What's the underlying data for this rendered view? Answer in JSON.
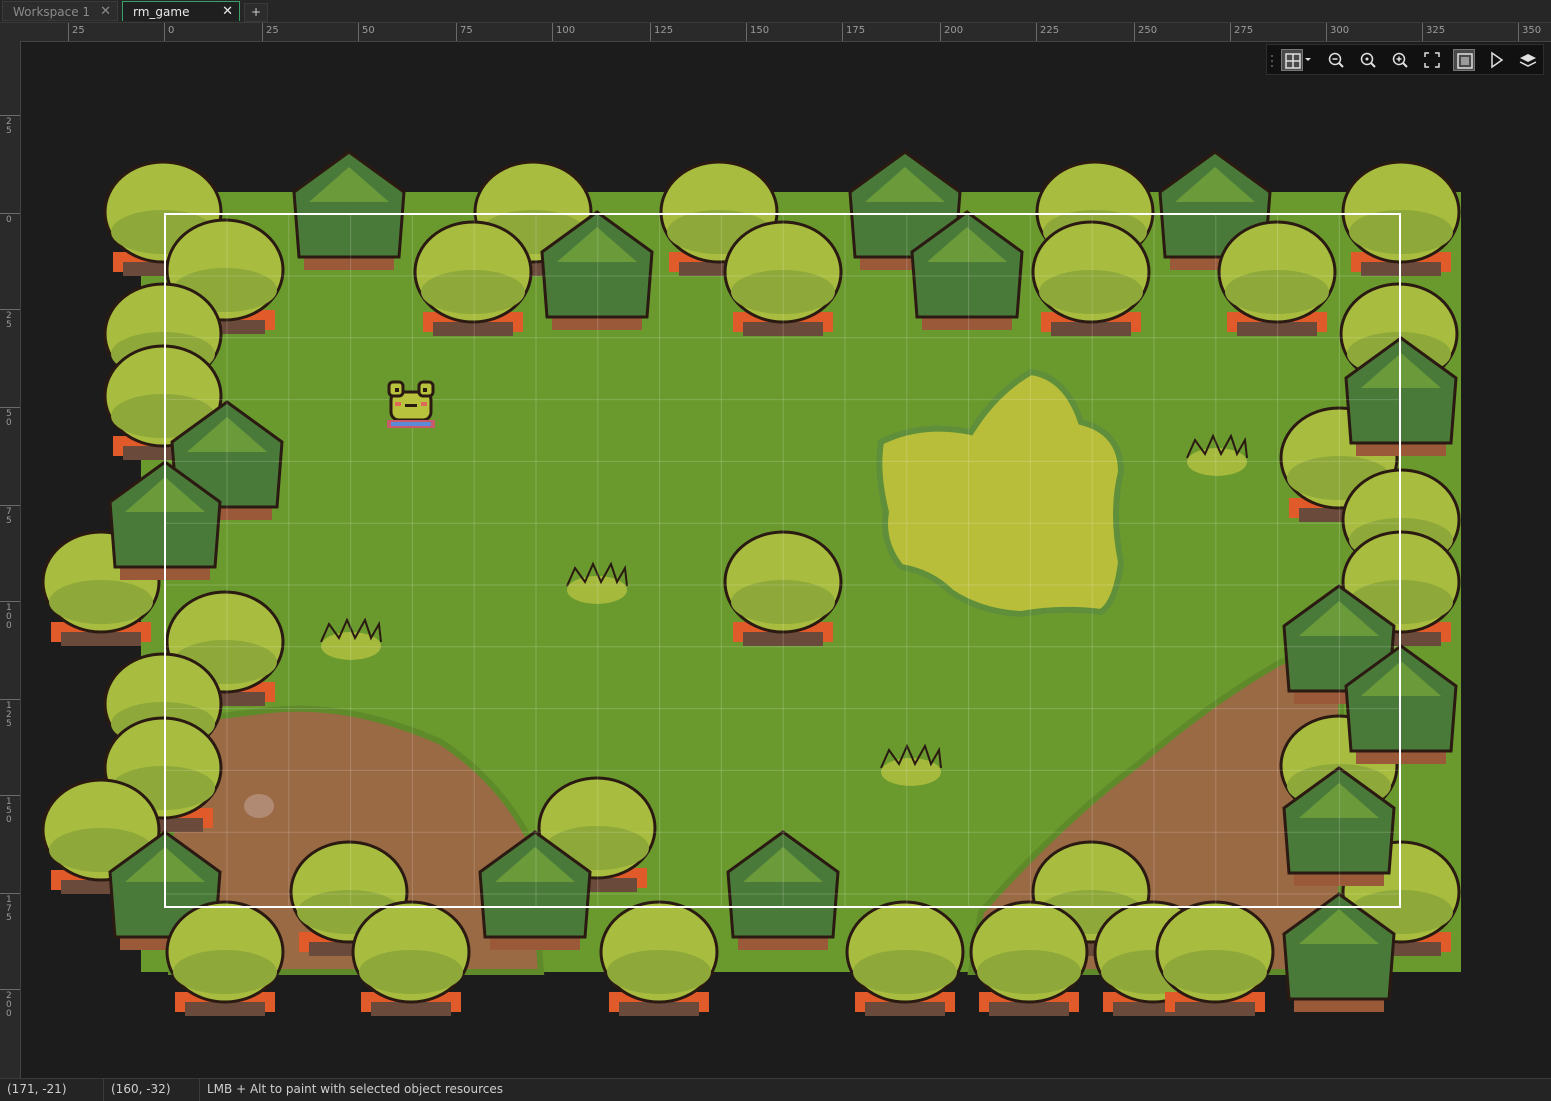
{
  "tabs": [
    {
      "label": "Workspace 1",
      "close": "✕"
    },
    {
      "label": "rm_game",
      "close": "✕"
    }
  ],
  "tab_add": "+",
  "ruler_top_labels": [
    "25",
    "0",
    "25",
    "50",
    "75",
    "100",
    "125",
    "150",
    "175",
    "200",
    "225",
    "250",
    "275",
    "300",
    "325",
    "350"
  ],
  "ruler_left_labels": [
    "25",
    "0",
    "25",
    "50",
    "75",
    "100",
    "125",
    "150",
    "175",
    "200"
  ],
  "toolbar": {
    "icons": [
      "grid-toggle-icon",
      "dropdown-arrow-icon",
      "zoom-out-icon",
      "zoom-reset-icon",
      "zoom-in-icon",
      "fullscreen-icon",
      "room-bounds-icon",
      "play-icon",
      "layers-icon"
    ],
    "grid_active": true,
    "bounds_active": true
  },
  "statusbar": {
    "cursor_room": "(171, -21)",
    "cursor_grid": "(160, -32)",
    "hint": "LMB + Alt to paint with selected object resources"
  },
  "colors": {
    "grass": "#6a9a2e",
    "path": "#9a6a45",
    "sand": "#b9be3a",
    "bush": "#a8bd3f",
    "pine": "#4a7a3a",
    "trunk": "#e05a2a"
  }
}
